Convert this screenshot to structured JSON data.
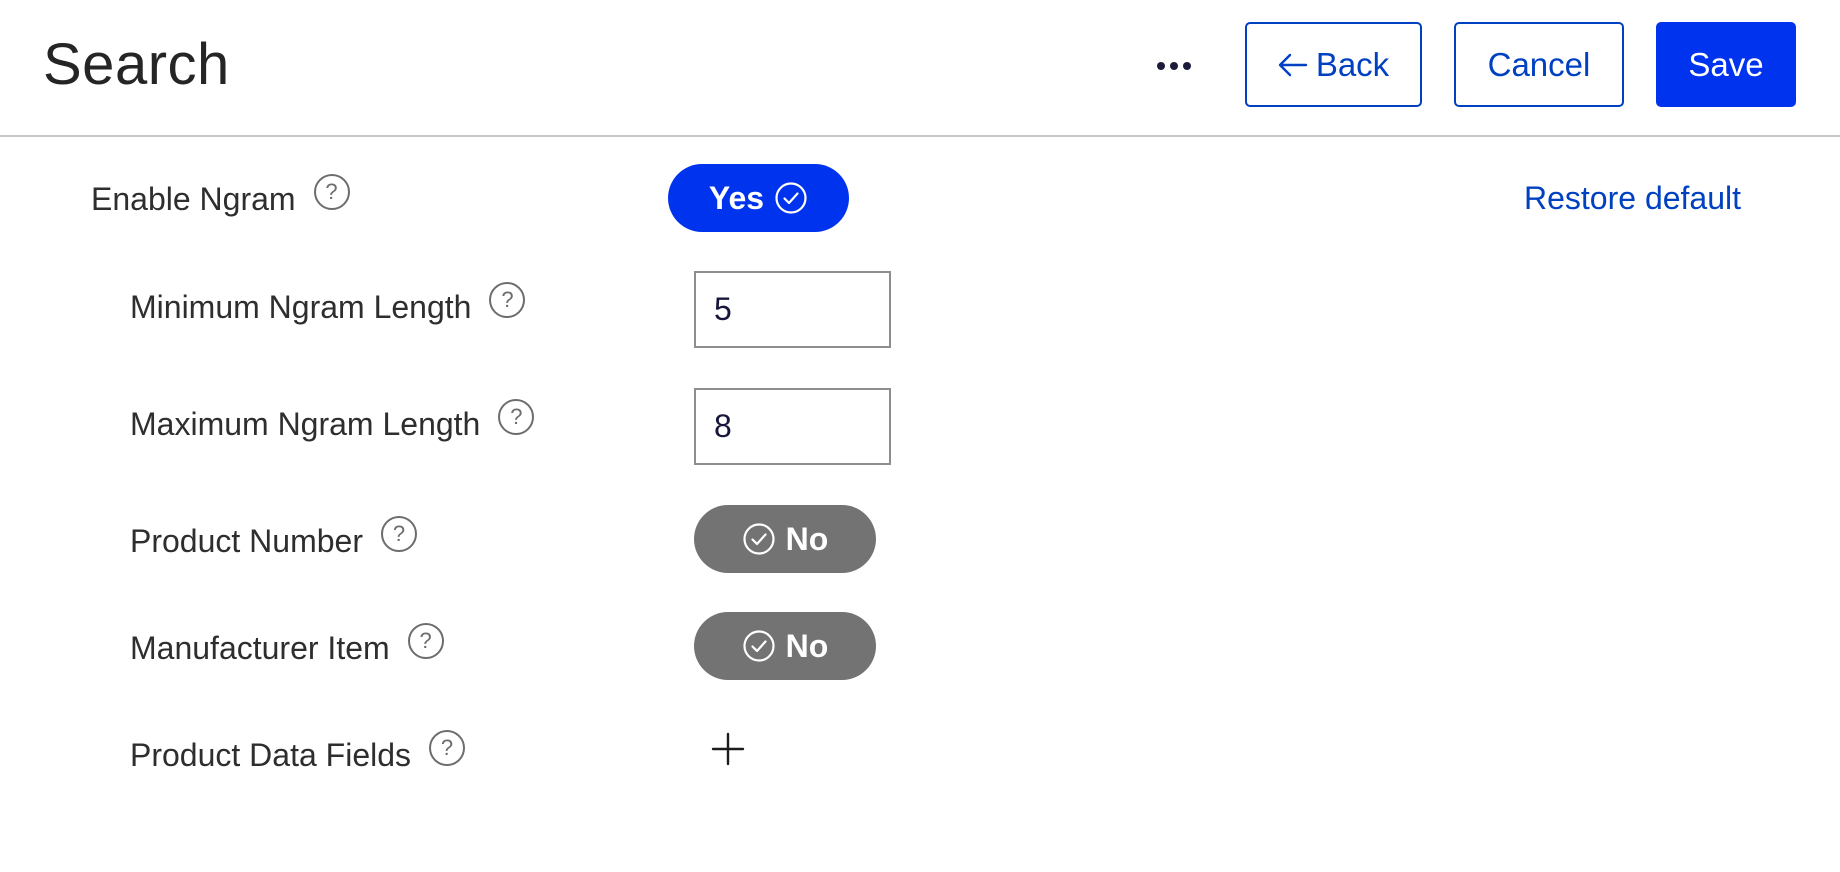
{
  "header": {
    "title": "Search",
    "more_icon": "more-horizontal-icon",
    "back_label": "Back",
    "back_icon": "arrow-left-icon",
    "cancel_label": "Cancel",
    "save_label": "Save"
  },
  "settings": {
    "enable_ngram": {
      "label": "Enable Ngram",
      "help": "?",
      "value": "Yes",
      "state": "on",
      "restore_label": "Restore default"
    },
    "min_ngram": {
      "label": "Minimum Ngram Length",
      "help": "?",
      "value": "5"
    },
    "max_ngram": {
      "label": "Maximum Ngram Length",
      "help": "?",
      "value": "8"
    },
    "product_number": {
      "label": "Product Number",
      "help": "?",
      "value": "No",
      "state": "off"
    },
    "manufacturer_item": {
      "label": "Manufacturer Item",
      "help": "?",
      "value": "No",
      "state": "off"
    },
    "product_data_fields": {
      "label": "Product Data Fields",
      "help": "?",
      "add_icon": "plus-icon"
    }
  },
  "colors": {
    "primary": "#0033ee",
    "link": "#0041c2",
    "toggle_off": "#737373",
    "divider": "#c6c6c6"
  }
}
